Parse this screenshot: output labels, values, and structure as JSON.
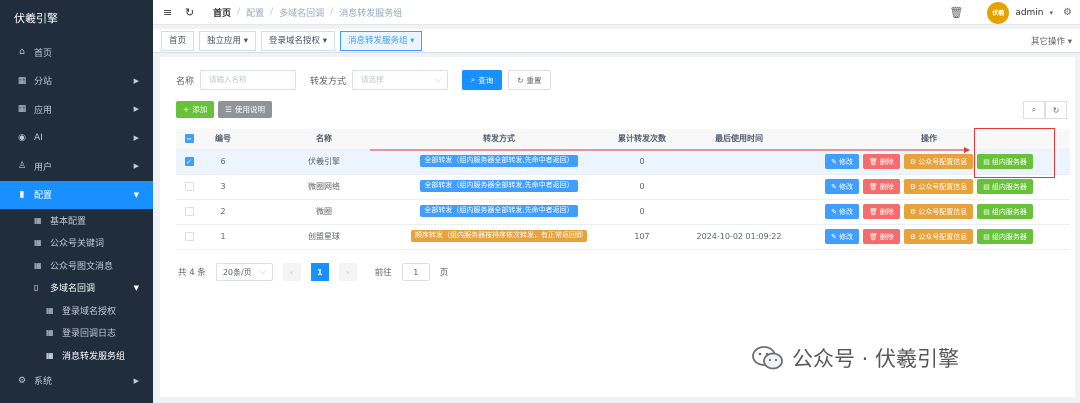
{
  "sidebar": {
    "logo": "伏羲引擎",
    "items": [
      {
        "label": "首页",
        "icon": "home-icon",
        "glyph": "⌂"
      },
      {
        "label": "分站",
        "icon": "building-icon",
        "glyph": "▦"
      },
      {
        "label": "应用",
        "icon": "grid-icon",
        "glyph": "▦"
      },
      {
        "label": "AI",
        "icon": "pin-icon",
        "glyph": "◉"
      },
      {
        "label": "用户",
        "icon": "user-icon",
        "glyph": "♙"
      },
      {
        "label": "配置",
        "icon": "chart-icon",
        "glyph": "▮"
      }
    ],
    "config_sub": [
      {
        "label": "基本配置"
      },
      {
        "label": "公众号关键词"
      },
      {
        "label": "公众号图文消息"
      },
      {
        "label": "多域名回调"
      }
    ],
    "callback_sub": [
      {
        "label": "登录域名授权"
      },
      {
        "label": "登录回调日志"
      },
      {
        "label": "消息转发服务组"
      }
    ],
    "system_label": "系统"
  },
  "topbar": {
    "breadcrumb": [
      "首页",
      "配置",
      "多域名回调",
      "消息转发服务组"
    ],
    "avatar_text": "伏羲",
    "user": "admin"
  },
  "tags": {
    "items": [
      "首页",
      "独立应用 ▾",
      "登录域名授权 ▾",
      "消息转发服务组 ▾"
    ],
    "other_ops": "其它操作 ▾"
  },
  "search": {
    "name_label": "名称",
    "name_placeholder": "请输入名称",
    "mode_label": "转发方式",
    "mode_placeholder": "请选择",
    "query_btn": "查询",
    "reset_btn": "重置"
  },
  "toolbar": {
    "add_btn": "添加",
    "help_btn": "使用说明"
  },
  "table": {
    "headers": [
      "编号",
      "名称",
      "转发方式",
      "累计转发次数",
      "最后使用时间",
      "操作"
    ],
    "rows": [
      {
        "id": "6",
        "name": "伏羲引擎",
        "mode": "全部转发（组内服务器全部转发,先命中者返回）",
        "mode_color": "blue",
        "count": "0",
        "last": "",
        "selected": true
      },
      {
        "id": "3",
        "name": "微圈网络",
        "mode": "全部转发（组内服务器全部转发,先命中者返回）",
        "mode_color": "blue",
        "count": "0",
        "last": "",
        "selected": false
      },
      {
        "id": "2",
        "name": "微圈",
        "mode": "全部转发（组内服务器全部转发,先命中者返回）",
        "mode_color": "blue",
        "count": "0",
        "last": "",
        "selected": false
      },
      {
        "id": "1",
        "name": "创盟星球",
        "mode": "顺序转发（组内服务器按排序依次转发，有正常返回即",
        "mode_color": "orange",
        "count": "107",
        "last": "2024-10-02 01:09:22",
        "selected": false
      }
    ],
    "ops": {
      "edit": "修改",
      "delete": "删除",
      "mp_config": "公众号配置信息",
      "group_server": "组内服务器"
    }
  },
  "pagination": {
    "total": "共 4 条",
    "page_size": "20条/页",
    "current": "1",
    "goto_label": "前往",
    "goto_value": "1",
    "page_suffix": "页"
  },
  "watermark": "公众号 · 伏羲引擎",
  "colors": {
    "sidebar_bg": "#1f2d3d",
    "primary": "#1890ff",
    "success": "#67c23a",
    "warning": "#e6a23c",
    "danger": "#f56c6c",
    "annotation": "#e53935"
  }
}
